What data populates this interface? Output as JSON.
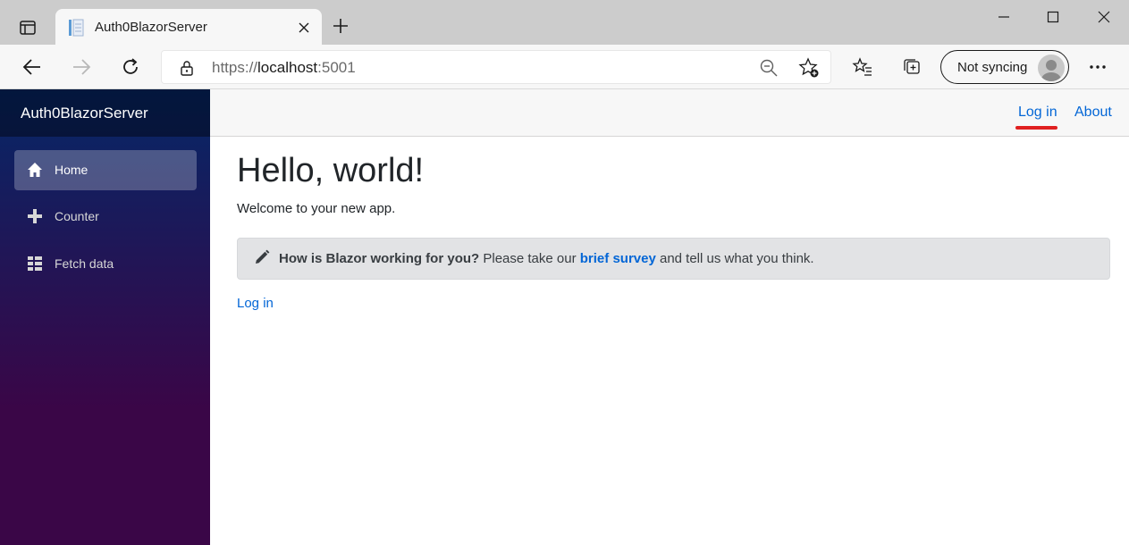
{
  "browser": {
    "tab_title": "Auth0BlazorServer",
    "address": {
      "scheme": "https://",
      "host": "localhost",
      "port": ":5001"
    },
    "sync_label": "Not syncing"
  },
  "sidebar": {
    "brand": "Auth0BlazorServer",
    "items": [
      {
        "label": "Home",
        "icon": "home-icon",
        "active": true
      },
      {
        "label": "Counter",
        "icon": "plus-icon",
        "active": false
      },
      {
        "label": "Fetch data",
        "icon": "list-icon",
        "active": false
      }
    ]
  },
  "top_row": {
    "login": "Log in",
    "about": "About"
  },
  "main": {
    "title": "Hello, world!",
    "welcome": "Welcome to your new app.",
    "survey": {
      "question": "How is Blazor working for you?",
      "before": " Please take our ",
      "link": "brief survey",
      "after": " and tell us what you think."
    },
    "login_link": "Log in"
  },
  "colors": {
    "accent": "#0366d6",
    "highlight": "#e02020",
    "sidebar_top": "#052767",
    "sidebar_bottom": "#3a0647"
  }
}
